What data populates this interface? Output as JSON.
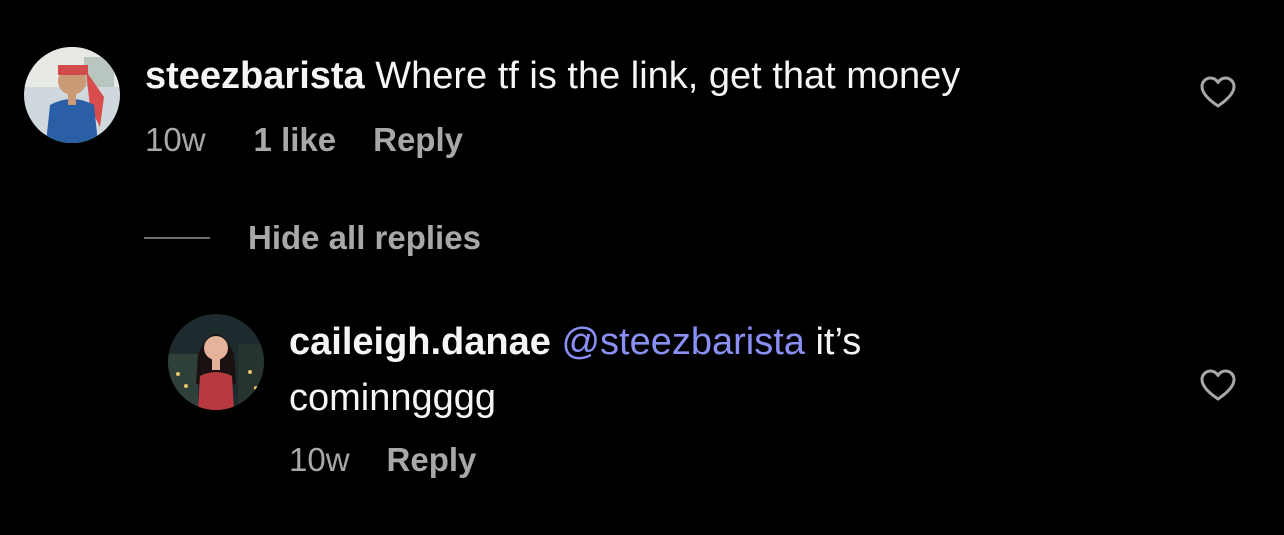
{
  "comment": {
    "username": "steezbarista",
    "text": "Where tf is the link, get that money",
    "time": "10w",
    "likes": "1 like",
    "reply_label": "Reply"
  },
  "thread": {
    "hide_replies_label": "Hide all replies"
  },
  "reply": {
    "username": "caileigh.danae",
    "mention": "@steezbarista",
    "text_line1_rest": "it’s",
    "text_line2": "cominngggg",
    "time": "10w",
    "reply_label": "Reply"
  },
  "colors": {
    "background": "#000000",
    "primary_text": "#f5f5f5",
    "secondary_text": "#a8a8a8",
    "mention": "#8a8ff5"
  },
  "icons": [
    "heart-icon"
  ]
}
